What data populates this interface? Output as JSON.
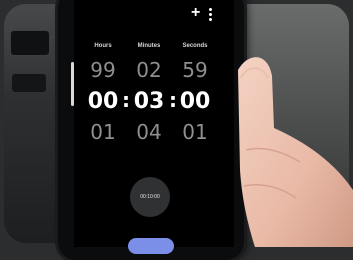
{
  "timer": {
    "labels": {
      "hours": "Hours",
      "minutes": "Minutes",
      "seconds": "Seconds"
    },
    "above": {
      "hours": "99",
      "minutes": "02",
      "seconds": "59"
    },
    "current": {
      "hours": "00",
      "minutes": "03",
      "seconds": "00"
    },
    "below": {
      "hours": "01",
      "minutes": "04",
      "seconds": "01"
    },
    "separator": ":",
    "preset_label": "00:10:00"
  },
  "toolbar": {
    "add_glyph": "+"
  },
  "icons": [
    "add-icon",
    "more-options-icon"
  ],
  "colors": {
    "background": "#000000",
    "text": "#ffffff",
    "dim_text": "#8f8f8f",
    "start_button": "#7b8fe8"
  }
}
